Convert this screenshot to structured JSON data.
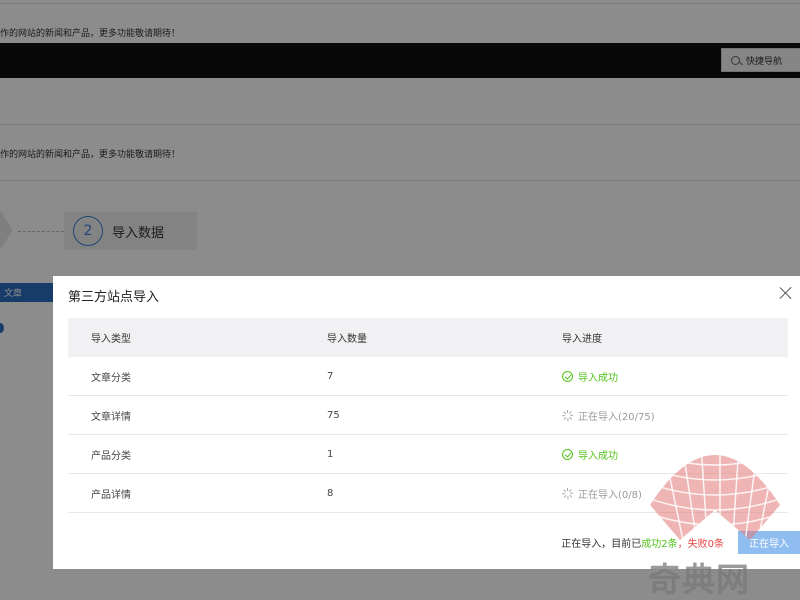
{
  "background": {
    "notice_top": "作的网站的新闻和产品，更多功能敬请期待！",
    "notice_mid": "作的网站的新闻和产品，更多功能敬请期待！",
    "quick_nav_label": "快捷导航",
    "step_number": "2",
    "step_label": "导入数据",
    "tab_label": "文章"
  },
  "modal": {
    "title": "第三方站点导入",
    "columns": [
      "导入类型",
      "导入数量",
      "导入进度"
    ],
    "rows": [
      {
        "type": "文章分类",
        "count": "7",
        "status": "导入成功",
        "state": "success"
      },
      {
        "type": "文章详情",
        "count": "75",
        "status": "正在导入(20/75)",
        "state": "pending"
      },
      {
        "type": "产品分类",
        "count": "1",
        "status": "导入成功",
        "state": "success"
      },
      {
        "type": "产品详情",
        "count": "8",
        "status": "正在导入(0/8)",
        "state": "pending"
      }
    ],
    "footer": {
      "prefix": "正在导入，目前已",
      "success_text": "成功2条",
      "separator": "，",
      "fail_text": "失败0条",
      "button_label": "正在导入"
    }
  },
  "watermark": {
    "text": "奇典网"
  },
  "colors": {
    "success": "#52c41a",
    "fail": "#e64545",
    "accent": "#3d7fd6",
    "button": "#8fbdf0"
  }
}
